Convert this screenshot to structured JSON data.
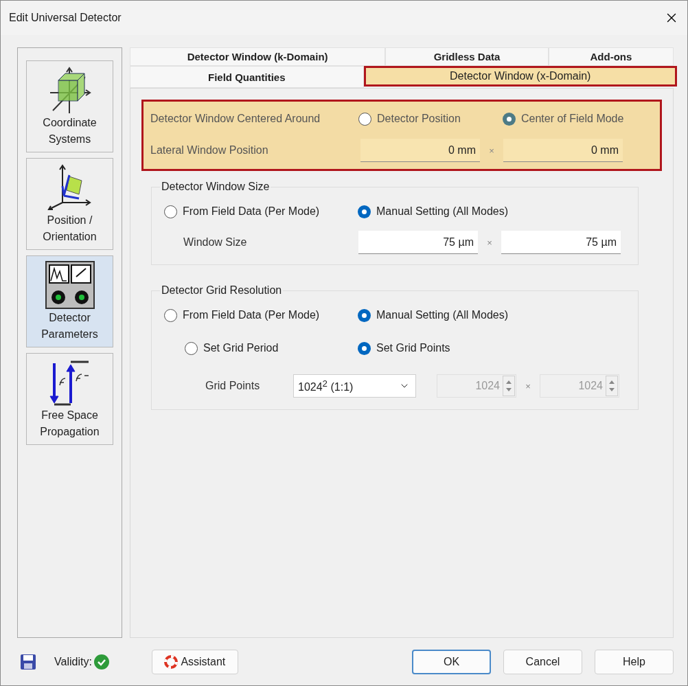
{
  "window": {
    "title": "Edit Universal Detector"
  },
  "sidebar": {
    "items": [
      {
        "lines": [
          "Coordinate",
          "Systems"
        ],
        "kind": "axes",
        "selected": false
      },
      {
        "lines": [
          "Position /",
          "Orientation"
        ],
        "kind": "pose",
        "selected": false
      },
      {
        "lines": [
          "Detector",
          "Parameters"
        ],
        "kind": "detector",
        "selected": true
      },
      {
        "lines": [
          "Free Space",
          "Propagation"
        ],
        "kind": "fourier",
        "selected": false
      }
    ]
  },
  "tabs": {
    "rows": [
      [
        {
          "label": "Detector Window (k-Domain)",
          "selected": false,
          "highlighted": false
        },
        {
          "label": "Gridless Data",
          "selected": false,
          "highlighted": false
        },
        {
          "label": "Add-ons",
          "selected": false,
          "highlighted": false
        }
      ],
      [
        {
          "label": "Field Quantities",
          "selected": false,
          "highlighted": false
        },
        {
          "label": "Detector Window (x-Domain)",
          "selected": true,
          "highlighted": true
        }
      ]
    ]
  },
  "centering": {
    "highlighted": true,
    "label": "Detector Window Centered Around",
    "options": [
      {
        "label": "Detector Position",
        "selected": false
      },
      {
        "label": "Center of Field Mode",
        "selected": true
      }
    ],
    "position": {
      "label": "Lateral Window Position",
      "values": [
        "0 mm",
        "0 mm"
      ],
      "separator": "×"
    }
  },
  "window_size": {
    "title": "Detector Window Size",
    "options": [
      {
        "label": "From Field Data (Per Mode)",
        "selected": false
      },
      {
        "label": "Manual Setting (All Modes)",
        "selected": true
      }
    ],
    "size": {
      "label": "Window Size",
      "values": [
        "75 µm",
        "75 µm"
      ],
      "separator": "×"
    }
  },
  "grid_resolution": {
    "title": "Detector Grid Resolution",
    "options": [
      {
        "label": "From Field Data (Per Mode)",
        "selected": false
      },
      {
        "label": "Manual Setting (All Modes)",
        "selected": true
      }
    ],
    "sub_options": [
      {
        "label": "Set Grid Period",
        "selected": false
      },
      {
        "label": "Set Grid Points",
        "selected": true
      }
    ],
    "grid_points": {
      "label": "Grid Points",
      "dropdown": "1024$^{2}$ (1:1)",
      "values": [
        "1024",
        "1024"
      ],
      "separator": "×",
      "disabled": true
    }
  },
  "footer": {
    "validity_label": "Validity:",
    "valid": true,
    "assistant": "Assistant",
    "buttons": [
      {
        "label": "OK",
        "default": true
      },
      {
        "label": "Cancel",
        "default": false
      },
      {
        "label": "Help",
        "default": false
      }
    ]
  }
}
